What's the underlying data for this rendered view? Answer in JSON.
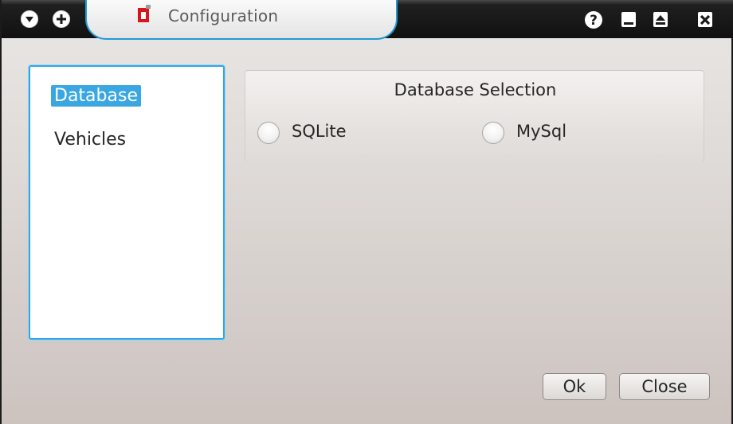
{
  "window": {
    "title": "Configuration",
    "app_icon": "app-red-square-icon"
  },
  "titlebar": {
    "left_buttons": [
      {
        "icon": "menu-down-icon"
      },
      {
        "icon": "pin-plus-icon"
      }
    ],
    "right_buttons": [
      {
        "icon": "help-icon",
        "glyph": "?"
      },
      {
        "icon": "minimize-icon"
      },
      {
        "icon": "maximize-icon"
      },
      {
        "icon": "close-icon"
      }
    ],
    "accent_color": "#1f9ad6"
  },
  "sidebar": {
    "items": [
      {
        "label": "Database",
        "selected": true
      },
      {
        "label": "Vehicles",
        "selected": false
      }
    ],
    "selection_color": "#3ba7e2"
  },
  "database_group": {
    "title": "Database Selection",
    "options": [
      {
        "label": "SQLite",
        "checked": false
      },
      {
        "label": "MySql",
        "checked": false
      }
    ]
  },
  "buttons": {
    "ok_label": "Ok",
    "close_label": "Close"
  }
}
